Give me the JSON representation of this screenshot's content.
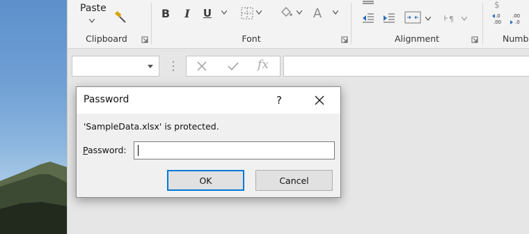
{
  "ribbon": {
    "clipboard": {
      "paste_label": "Paste",
      "group_label": "Clipboard"
    },
    "font": {
      "group_label": "Font",
      "bold": "B",
      "italic": "I",
      "underline": "U",
      "font_color_glyph": "A"
    },
    "alignment": {
      "group_label": "Alignment"
    },
    "number": {
      "group_label": "Numbe",
      "dollar": "$",
      "dec_up": ".0\n.00",
      "dec_down": ".00\n.0"
    }
  },
  "formula_bar": {
    "name_box_value": "",
    "fx_glyph": "fx",
    "formula_value": ""
  },
  "dialog": {
    "title": "Password",
    "help_glyph": "?",
    "message": "'SampleData.xlsx' is protected.",
    "password_label_accel": "P",
    "password_label_rest": "assword:",
    "password_value": "",
    "ok_label": "OK",
    "cancel_label": "Cancel"
  },
  "colors": {
    "default_button_border": "#0078d7",
    "ribbon_bg": "#f3f3f3",
    "workspace_bg": "#e6e6e6",
    "sky": "#6f9fd4"
  }
}
